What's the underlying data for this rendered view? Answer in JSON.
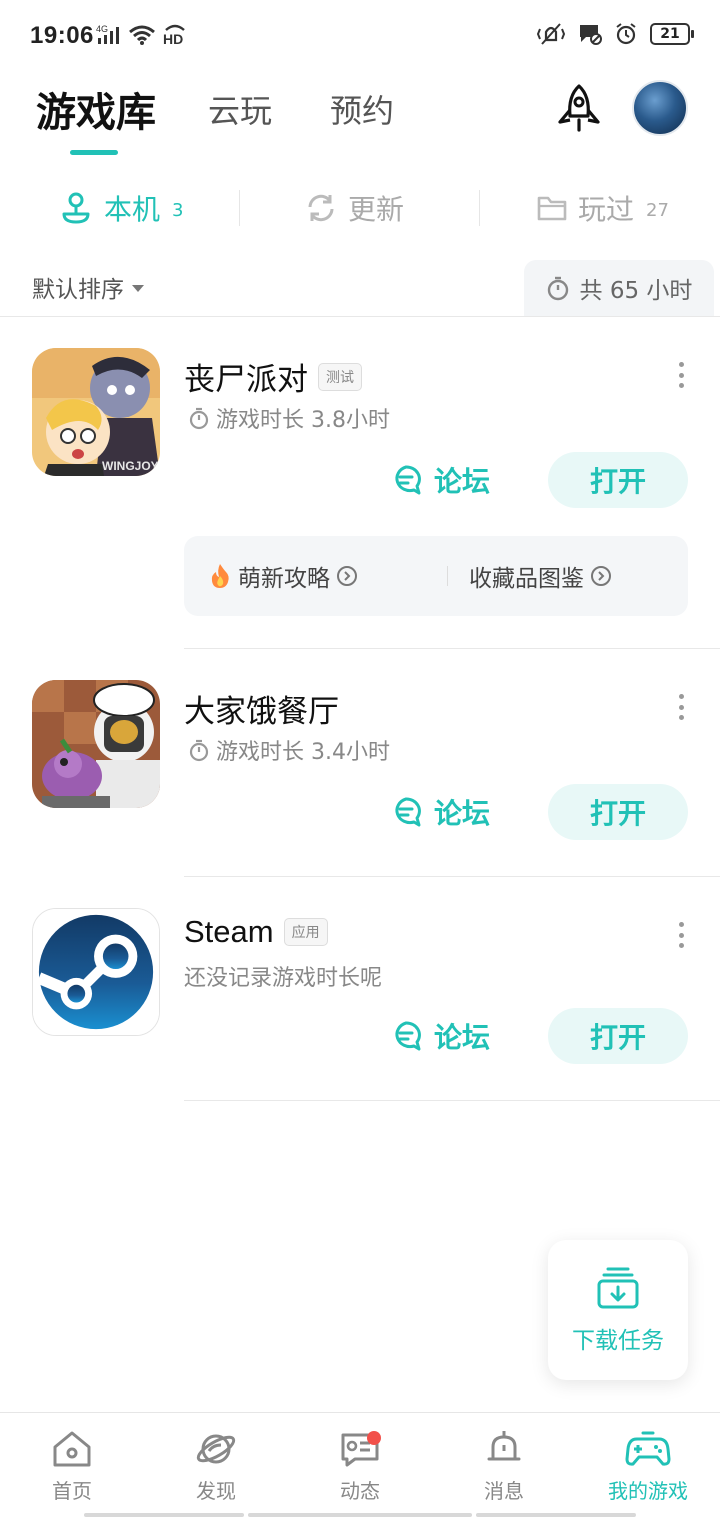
{
  "status_bar": {
    "time": "19:06",
    "network": "4G",
    "hd": "HD",
    "battery": "21"
  },
  "header": {
    "tabs": [
      {
        "label": "游戏库",
        "active": true
      },
      {
        "label": "云玩",
        "active": false
      },
      {
        "label": "预约",
        "active": false
      }
    ]
  },
  "subtabs": [
    {
      "label": "本机",
      "count": "3",
      "icon": "device-icon",
      "active": true
    },
    {
      "label": "更新",
      "count": "",
      "icon": "refresh-icon",
      "active": false
    },
    {
      "label": "玩过",
      "count": "27",
      "icon": "folder-icon",
      "active": false
    }
  ],
  "sort": {
    "label": "默认排序",
    "total_playtime": "共 65 小时"
  },
  "games": [
    {
      "title": "丧尸派对",
      "tag": "测试",
      "meta": "游戏时长 3.8小时",
      "forum_label": "论坛",
      "open_label": "打开",
      "guides": [
        {
          "label": "萌新攻略",
          "icon": "fire-icon"
        },
        {
          "label": "收藏品图鉴",
          "icon": ""
        }
      ]
    },
    {
      "title": "大家饿餐厅",
      "tag": "",
      "meta": "游戏时长 3.4小时",
      "forum_label": "论坛",
      "open_label": "打开"
    },
    {
      "title": "Steam",
      "tag": "应用",
      "meta": "还没记录游戏时长呢",
      "forum_label": "论坛",
      "open_label": "打开"
    }
  ],
  "download_fab": {
    "label": "下载任务"
  },
  "bottom_nav": [
    {
      "label": "首页",
      "icon": "home-icon",
      "active": false
    },
    {
      "label": "发现",
      "icon": "planet-icon",
      "active": false
    },
    {
      "label": "动态",
      "icon": "feed-icon",
      "active": false,
      "badge": true
    },
    {
      "label": "消息",
      "icon": "bell-icon",
      "active": false
    },
    {
      "label": "我的游戏",
      "icon": "gamepad-icon",
      "active": true
    }
  ],
  "colors": {
    "accent": "#21c1b6",
    "accent_bg": "#e8f8f7",
    "badge": "#f2504a"
  }
}
